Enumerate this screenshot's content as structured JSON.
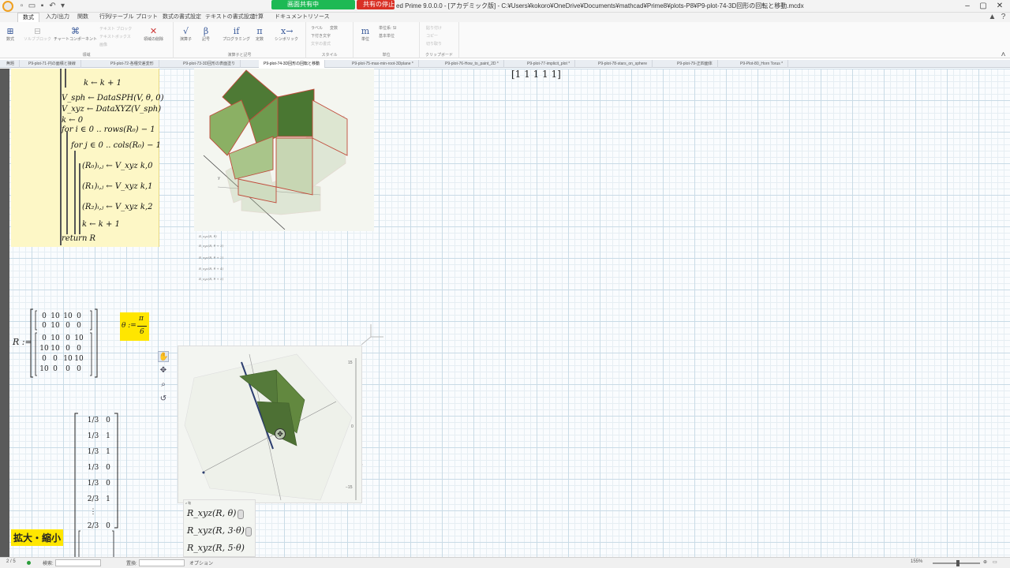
{
  "titlebar": {
    "share_label": "画面共有中",
    "stop_label": "共有の停止",
    "window_title": "ed Prime 9.0.0.0 - [アカデミック版] - C:¥Users¥kokoro¥OneDrive¥Documents¥mathcad¥Prime8¥plots-P8¥P9-plot-74-3D回形の回転と移動.mcdx"
  },
  "ribbon_tabs": [
    "数式",
    "入力/出力",
    "関数",
    "行列/テーブル",
    "プロット",
    "数式の書式設定",
    "テキストの書式設定",
    "計算",
    "ドキュメント",
    "リソース"
  ],
  "ribbon": {
    "group_region": "領域",
    "group_operators": "演算子と記号",
    "group_style": "スタイル",
    "group_units": "単位",
    "group_clipboard": "クリップボード",
    "btn_math": "数式",
    "btn_solve_block": "ソルブブロック",
    "btn_chart": "チャートコンポーネント",
    "btn_text_block": "テキスト ブロック",
    "btn_text_box": "テキストボックス",
    "btn_image": "画像",
    "btn_delete_region": "領域の削除",
    "btn_operators": "演算子",
    "btn_symbols": "記号",
    "btn_programming": "プログラミング",
    "btn_constants": "定数",
    "btn_symbolic": "シンボリック",
    "label_label": "ラベル",
    "label_value": "変数",
    "label_subscript": "下付き文字",
    "label_style_format": "文字の書式",
    "units_label": "単位",
    "unit_system": "単位系: SI",
    "base_units": "基本単位",
    "clip_paste": "貼り付け",
    "clip_copy": "コピー",
    "clip_cut": "切り取り"
  },
  "doc_tabs": [
    "無題",
    "P9-plot-71-円の面積と接線",
    "P9-plot-72-各種交差変形",
    "P9-plot-73-3D回形の表面塗り",
    "P9-plot-74-3D回形の回転と移動",
    "P9-plot-75-max-min-root-3Dplane *",
    "P9-plot-76-How_to_paint_2D *",
    "P9-plot-77-implicit_plot *",
    "P9-plot-78-stars_on_sphere",
    "P9-plot-79-正四面体",
    "P9-Plot-80_Horn Torus *"
  ],
  "program": {
    "l1": "k ← k + 1",
    "l2": "V_sph ← DataSPH(V, θ, 0)",
    "l3": "V_xyz ← DataXYZ(V_sph)",
    "l4": "k ← 0",
    "l5": "for i ∈ 0 .. rows(R₀) − 1",
    "l6": "for j ∈ 0 .. cols(R₀) − 1",
    "l7": "(R₀)ᵢ,ⱼ ← V_xyz k,0",
    "l8": "(R₁)ᵢ,ⱼ ← V_xyz k,1",
    "l9": "(R₂)ᵢ,ⱼ ← V_xyz k,2",
    "l10": "k ← k + 1",
    "l11": "return R"
  },
  "plot_top_legend": [
    "R_xyz(R, θ)",
    "R_xyz(R, θ + 3)",
    "R_xyz(R, θ + 2)",
    "R_xyz(R, θ + 4)",
    "R_xyz(R, θ + 5)"
  ],
  "top_vector": "[1 1 1 1 1]",
  "r_matrix": {
    "label": "R :=",
    "block1": [
      [
        "0",
        "10",
        "10",
        "0"
      ],
      [
        "0",
        "10",
        "0",
        "0"
      ]
    ],
    "block2": [
      [
        "0",
        "10",
        "0",
        "10"
      ],
      [
        "10",
        "10",
        "0",
        "0"
      ],
      [
        "0",
        "0",
        "10",
        "10"
      ],
      [
        "10",
        "0",
        "0",
        "0"
      ]
    ]
  },
  "theta_def": {
    "lhs": "θ :=",
    "num": "π",
    "den": "6"
  },
  "plot_bottom": {
    "tick_top": "15",
    "tick_mid": "0",
    "tick_bottom": "−15",
    "legend_caption": "z 軸",
    "rows": [
      "R_xyz(R, θ)",
      "R_xyz(R, 3·θ)",
      "R_xyz(R, 5·θ)"
    ]
  },
  "big_vector": {
    "rows": [
      [
        "1/3",
        "0"
      ],
      [
        "1/3",
        "1"
      ],
      [
        "1/3",
        "1"
      ],
      [
        "1/3",
        "0"
      ],
      [
        "1/3",
        "0"
      ],
      [
        "2/3",
        "1"
      ],
      [
        "⋮",
        ""
      ]
    ],
    "next": [
      "2/3",
      "0"
    ]
  },
  "zoom_label": "拡大・縮小",
  "statusbar": {
    "page": "2 / 5",
    "find": "検索:",
    "replace": "置換:",
    "options": "オプション",
    "zoom": "155%"
  },
  "colors": {
    "share_green": "#1db954",
    "stop_red": "#d93025",
    "highlight_yellow": "#ffe600",
    "program_bg": "#fdf7c6",
    "plot_green": "#557a3a"
  }
}
